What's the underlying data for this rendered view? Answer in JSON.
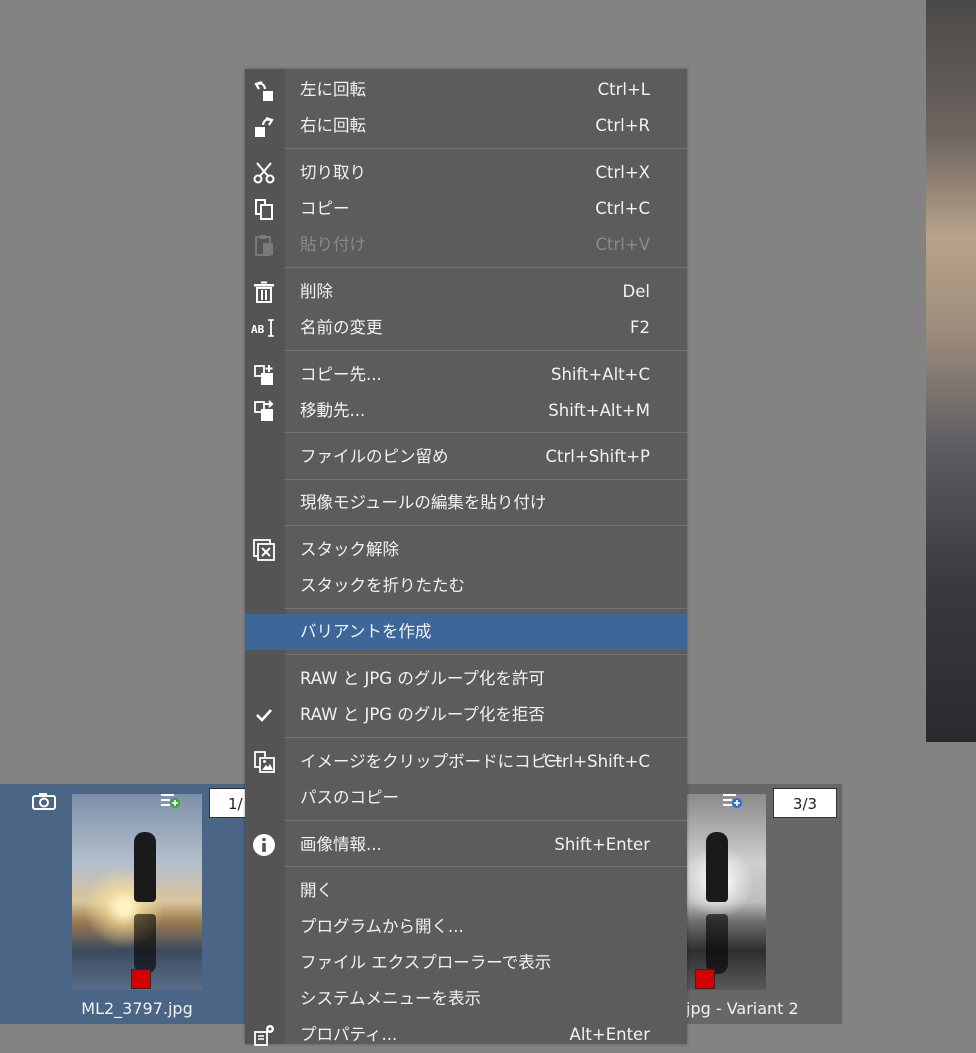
{
  "menu": {
    "items": [
      {
        "label": "左に回転",
        "shortcut": "Ctrl+L",
        "icon": "rotate-left-icon"
      },
      {
        "label": "右に回転",
        "shortcut": "Ctrl+R",
        "icon": "rotate-right-icon"
      },
      {
        "label": "切り取り",
        "shortcut": "Ctrl+X",
        "icon": "scissors-icon"
      },
      {
        "label": "コピー",
        "shortcut": "Ctrl+C",
        "icon": "copy-icon"
      },
      {
        "label": "貼り付け",
        "shortcut": "Ctrl+V",
        "icon": "paste-icon",
        "disabled": true
      },
      {
        "label": "削除",
        "shortcut": "Del",
        "icon": "trash-icon"
      },
      {
        "label": "名前の変更",
        "shortcut": "F2",
        "icon": "rename-icon"
      },
      {
        "label": "コピー先...",
        "shortcut": "Shift+Alt+C",
        "icon": "copy-to-icon"
      },
      {
        "label": "移動先...",
        "shortcut": "Shift+Alt+M",
        "icon": "move-to-icon"
      },
      {
        "label": "ファイルのピン留め",
        "shortcut": "Ctrl+Shift+P",
        "icon": ""
      },
      {
        "label": "現像モジュールの編集を貼り付け",
        "shortcut": "",
        "icon": ""
      },
      {
        "label": "スタック解除",
        "shortcut": "",
        "icon": "unstack-icon"
      },
      {
        "label": "スタックを折りたたむ",
        "shortcut": "",
        "icon": ""
      },
      {
        "label": "バリアントを作成",
        "shortcut": "",
        "icon": "",
        "highlighted": true
      },
      {
        "label": "RAW と JPG のグループ化を許可",
        "shortcut": "",
        "icon": ""
      },
      {
        "label": "RAW と JPG のグループ化を拒否",
        "shortcut": "",
        "icon": "checkmark-icon"
      },
      {
        "label": "イメージをクリップボードにコピー",
        "shortcut": "Ctrl+Shift+C",
        "icon": "copy-image-icon"
      },
      {
        "label": "パスのコピー",
        "shortcut": "",
        "icon": ""
      },
      {
        "label": "画像情報...",
        "shortcut": "Shift+Enter",
        "icon": "info-icon"
      },
      {
        "label": "開く",
        "shortcut": "",
        "icon": ""
      },
      {
        "label": "プログラムから開く...",
        "shortcut": "",
        "icon": ""
      },
      {
        "label": "ファイル エクスプローラーで表示",
        "shortcut": "",
        "icon": ""
      },
      {
        "label": "システムメニューを表示",
        "shortcut": "",
        "icon": ""
      },
      {
        "label": "プロパティ...",
        "shortcut": "Alt+Enter",
        "icon": "properties-icon"
      }
    ]
  },
  "filmstrip": {
    "thumb1": {
      "counter": "1/",
      "filename": "ML2_3797.jpg",
      "label_color": "#d40000"
    },
    "thumb3": {
      "counter": "3/3",
      "filename": "jpg - Variant 2",
      "label_color": "#d40000"
    }
  },
  "colors": {
    "highlight": "#3e6799",
    "menu_bg": "#5c5c5c",
    "selected_thumb": "#4a6585"
  }
}
